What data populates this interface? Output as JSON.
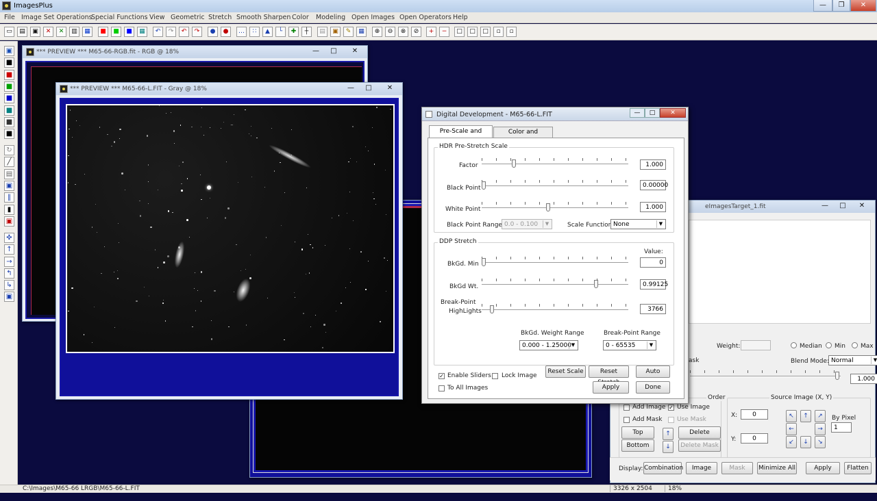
{
  "app": {
    "title": "ImagesPlus",
    "caption_buttons": [
      "—",
      "❐",
      "✕"
    ]
  },
  "menu": [
    "File",
    "Image Set Operations",
    "Special Functions",
    "View",
    "Geometric",
    "Stretch",
    "Smooth Sharpen",
    "Color",
    "Modeling",
    "Open Images",
    "Open Operators",
    "Help"
  ],
  "toolbar": [
    {
      "icon": "new-file-icon",
      "glyph": "▭"
    },
    {
      "icon": "open-folder-icon",
      "glyph": "▤"
    },
    {
      "icon": "save-icon",
      "glyph": "▣"
    },
    {
      "icon": "close-image-icon",
      "glyph": "✕",
      "color": "#c00000"
    },
    {
      "icon": "close-all-icon",
      "glyph": "✕",
      "color": "#008000"
    },
    {
      "icon": "copy-icon",
      "glyph": "▥"
    },
    {
      "icon": "rgb-channels-icon",
      "glyph": "▦",
      "color": "#0033cc"
    },
    {
      "icon": "red-channel-icon",
      "glyph": "■",
      "color": "#ff0000"
    },
    {
      "icon": "green-channel-icon",
      "glyph": "■",
      "color": "#00cc00"
    },
    {
      "icon": "blue-channel-icon",
      "glyph": "■",
      "color": "#0000ff"
    },
    {
      "icon": "grid-icon",
      "glyph": "▦",
      "color": "#008080"
    },
    {
      "icon": "undo-icon",
      "glyph": "↶",
      "color": "#1a3fb0"
    },
    {
      "icon": "redo-icon",
      "glyph": "↷",
      "color": "#888888"
    },
    {
      "icon": "undo-all-icon",
      "glyph": "↶",
      "color": "#c00000"
    },
    {
      "icon": "redo-all-icon",
      "glyph": "↷",
      "color": "#c00000"
    },
    {
      "icon": "record-icon",
      "glyph": "●",
      "color": "#1a3fb0"
    },
    {
      "icon": "stop-record-icon",
      "glyph": "●",
      "color": "#c00000"
    },
    {
      "icon": "dotted-line-icon",
      "glyph": "…",
      "color": "#1a3fb0"
    },
    {
      "icon": "dotted-cross-icon",
      "glyph": "∷",
      "color": "#1a3fb0"
    },
    {
      "icon": "histogram-icon",
      "glyph": "▲",
      "color": "#1a3fb0"
    },
    {
      "icon": "axis-icon",
      "glyph": "└",
      "color": "#1a3fb0"
    },
    {
      "icon": "crosshair-icon",
      "glyph": "✚",
      "color": "#008000"
    },
    {
      "icon": "cursor-cross-icon",
      "glyph": "┼"
    },
    {
      "icon": "ruler-icon",
      "glyph": "▤",
      "color": "#999999"
    },
    {
      "icon": "picture-icon",
      "glyph": "▣",
      "color": "#a06000"
    },
    {
      "icon": "pencil-icon",
      "glyph": "✎",
      "color": "#a08000"
    },
    {
      "icon": "table-icon",
      "glyph": "▦",
      "color": "#1a3fb0"
    },
    {
      "icon": "zoom-in-icon",
      "glyph": "⊕"
    },
    {
      "icon": "zoom-out-icon",
      "glyph": "⊖"
    },
    {
      "icon": "zoom-fit-icon",
      "glyph": "⊗"
    },
    {
      "icon": "zoom-actual-icon",
      "glyph": "⊘"
    },
    {
      "icon": "add-box-icon",
      "glyph": "+",
      "color": "#c00000"
    },
    {
      "icon": "remove-box-icon",
      "glyph": "−",
      "color": "#c00000"
    },
    {
      "icon": "window-layout-1-icon",
      "glyph": "□"
    },
    {
      "icon": "window-layout-2-icon",
      "glyph": "□"
    },
    {
      "icon": "window-layout-3-icon",
      "glyph": "□"
    },
    {
      "icon": "window-layout-4-icon",
      "glyph": "▫"
    },
    {
      "icon": "window-layout-5-icon",
      "glyph": "▫"
    }
  ],
  "left_toolbar": [
    {
      "icon": "save-disk-icon",
      "glyph": "▣"
    },
    {
      "icon": "black-square-icon",
      "glyph": "■",
      "color": "#000000"
    },
    {
      "icon": "red-channel-icon",
      "glyph": "■",
      "color": "#cc0000"
    },
    {
      "icon": "green-channel-icon",
      "glyph": "■",
      "color": "#00a000"
    },
    {
      "icon": "blue-channel-icon",
      "glyph": "■",
      "color": "#0000cc"
    },
    {
      "icon": "cyan-channel-icon",
      "glyph": "■",
      "color": "#008080"
    },
    {
      "icon": "gray-channel-icon",
      "glyph": "■",
      "color": "#333333"
    },
    {
      "icon": "luminance-icon",
      "glyph": "■",
      "color": "#000000"
    },
    {
      "icon": "refresh-icon",
      "glyph": "↻",
      "color": "#888888"
    },
    {
      "icon": "pen-tool-icon",
      "glyph": "╱",
      "color": "#333333"
    },
    {
      "icon": "mask-icon",
      "glyph": "▤",
      "color": "#666666"
    },
    {
      "icon": "box-select-icon",
      "glyph": "▣",
      "color": "#1a3fb0"
    },
    {
      "icon": "align-icon",
      "glyph": "‖",
      "color": "#1a3fb0"
    },
    {
      "icon": "frame-icon",
      "glyph": "▮",
      "color": "#000000"
    },
    {
      "icon": "crop-icon",
      "glyph": "▣",
      "color": "#c00000"
    },
    {
      "icon": "move-icon",
      "glyph": "✜",
      "color": "#1a3fb0"
    },
    {
      "icon": "arrow-up-icon",
      "glyph": "↑",
      "color": "#1a3fb0"
    },
    {
      "icon": "arrow-right-icon",
      "glyph": "→",
      "color": "#1a3fb0"
    },
    {
      "icon": "rotate-left-icon",
      "glyph": "↰",
      "color": "#1a3fb0"
    },
    {
      "icon": "rotate-right-icon",
      "glyph": "↳",
      "color": "#1a3fb0"
    },
    {
      "icon": "info-icon",
      "glyph": "▣",
      "color": "#1a3fb0"
    }
  ],
  "windows": {
    "rgb_preview": {
      "title": "*** PREVIEW *** M65-66-RGB.fit - RGB @ 18%",
      "buttons": [
        "—",
        "□",
        "✕"
      ]
    },
    "gray_preview": {
      "title": "*** PREVIEW *** M65-66-L.FIT - Gray @ 18%",
      "buttons": [
        "—",
        "□",
        "✕"
      ]
    },
    "combine": {
      "title": "eImagesTarget_1.fit",
      "buttons": [
        "—",
        "□",
        "✕"
      ]
    }
  },
  "dialog": {
    "title": "Digital Development - M65-66-L.FIT",
    "buttons": [
      "—",
      "□",
      "✕"
    ],
    "tabs": [
      "Pre-Scale and Stretch",
      "Color and Sharpness"
    ],
    "hdr": {
      "group": "HDR Pre-Stretch Scale",
      "factor": {
        "label": "Factor",
        "value": "1.000",
        "pos": 0.21
      },
      "black": {
        "label": "Black Point",
        "value": "0.00000",
        "pos": 0.0
      },
      "white": {
        "label": "White Point",
        "value": "1.000",
        "pos": 0.45
      },
      "black_range": {
        "label": "Black Point Range",
        "value": "0.0 - 0.100"
      },
      "scale_function": {
        "label": "Scale Function",
        "value": "None"
      }
    },
    "ddp": {
      "group": "DDP Stretch",
      "value_header": "Value:",
      "bkgd_min": {
        "label": "BkGd. Min",
        "value": "0",
        "pos": 0.0
      },
      "bkgd_wt": {
        "label": "BkGd Wt.",
        "value": "0.99125",
        "pos": 0.79
      },
      "bp_line1": "Break-Point",
      "bp_line2": "HighLights",
      "bp_value": "3766",
      "bp_pos": 0.06,
      "wt_range_label": "BkGd. Weight Range",
      "wt_range": "0.000 - 1.25000",
      "bp_range_label": "Break-Point Range",
      "bp_range": "0 - 65535"
    },
    "enable_sliders": "Enable Sliders",
    "lock_image": "Lock Image",
    "to_all": "To All Images",
    "reset_scale": "Reset Scale",
    "reset_stretch": "Reset Stretch",
    "auto": "Auto",
    "apply": "Apply",
    "done": "Done"
  },
  "combine": {
    "weight_label": "Weight:",
    "median": "Median",
    "min": "Min",
    "max": "Max",
    "mask_label": "ask",
    "blend_label": "Blend Mode:",
    "blend_value": "Normal",
    "opacity_value": "1.000",
    "order_label": "Order",
    "add_image": "Add Image",
    "use_image": "Use Image",
    "add_mask": "Add Mask",
    "use_mask": "Use Mask",
    "top": "Top",
    "bottom": "Bottom",
    "delete_image": "Delete Image",
    "delete_mask": "Delete Mask",
    "source_label": "Source Image (X, Y)",
    "x_label": "X:",
    "x_value": "0",
    "y_label": "Y:",
    "y_value": "0",
    "by_pixel": "By Pixel",
    "by_pixel_value": "1",
    "display_label": "Display:",
    "display_combination": "Combination",
    "display_image": "Image",
    "display_mask": "Mask",
    "minimize_all": "Minimize All",
    "apply": "Apply",
    "flatten": "Flatten"
  },
  "status": {
    "path": "C:\\Images\\M65-66 LRGB\\M65-66-L.FIT",
    "dims": "3326 x 2504",
    "zoom": "18%"
  }
}
